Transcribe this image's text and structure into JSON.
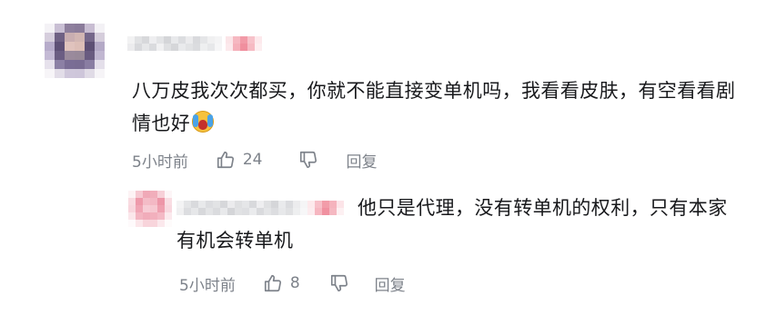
{
  "comment": {
    "text": "八万皮我次次都买，你就不能直接变单机吗，我看看皮肤，有空看看剧情也好",
    "emoji_icon": "loudly-crying-face-icon",
    "time": "5小时前",
    "like_count": "24",
    "reply_label": "回复"
  },
  "reply": {
    "text": "他只是代理，没有转单机的权利，只有本家有机会转单机",
    "time": "5小时前",
    "like_count": "8",
    "reply_label": "回复"
  },
  "colors": {
    "text": "#18191c",
    "meta": "#7d828a",
    "background": "#ffffff"
  }
}
